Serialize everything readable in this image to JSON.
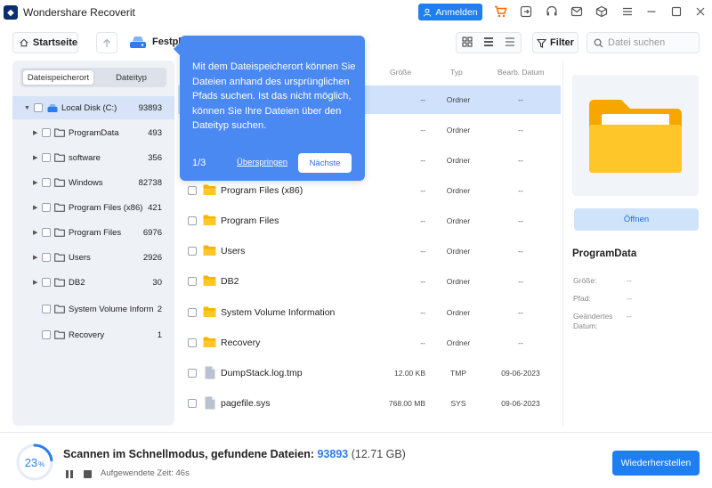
{
  "app": {
    "title": "Wondershare Recoverit",
    "login_label": "Anmelden"
  },
  "toolbar": {
    "home_label": "Startseite",
    "drive_label": "Festpla",
    "filter_label": "Filter",
    "search_placeholder": "Datei suchen"
  },
  "left": {
    "tabs": [
      {
        "label": "Dateispeicherort",
        "active": true
      },
      {
        "label": "Dateityp",
        "active": false
      }
    ],
    "root": {
      "label": "Local Disk (C:)",
      "count": "93893"
    },
    "items": [
      {
        "label": "ProgramData",
        "count": "493",
        "expandable": true
      },
      {
        "label": "software",
        "count": "356",
        "expandable": true
      },
      {
        "label": "Windows",
        "count": "82738",
        "expandable": true
      },
      {
        "label": "Program Files (x86)",
        "count": "421",
        "expandable": true
      },
      {
        "label": "Program Files",
        "count": "6976",
        "expandable": true
      },
      {
        "label": "Users",
        "count": "2926",
        "expandable": true
      },
      {
        "label": "DB2",
        "count": "30",
        "expandable": true
      },
      {
        "label": "System Volume Inform...",
        "count": "2",
        "expandable": false
      },
      {
        "label": "Recovery",
        "count": "1",
        "expandable": false
      }
    ]
  },
  "list": {
    "headers": {
      "size": "Größe",
      "type": "Typ",
      "date": "Bearb. Datum"
    },
    "rows": [
      {
        "name": "",
        "size": "--",
        "type": "Ordner",
        "date": "--",
        "kind": "hidden"
      },
      {
        "name": "",
        "size": "--",
        "type": "Ordner",
        "date": "--",
        "kind": "hidden"
      },
      {
        "name": "",
        "size": "--",
        "type": "Ordner",
        "date": "--",
        "kind": "hidden"
      },
      {
        "name": "Program Files (x86)",
        "size": "--",
        "type": "Ordner",
        "date": "--",
        "kind": "folder"
      },
      {
        "name": "Program Files",
        "size": "--",
        "type": "Ordner",
        "date": "--",
        "kind": "folder"
      },
      {
        "name": "Users",
        "size": "--",
        "type": "Ordner",
        "date": "--",
        "kind": "folder"
      },
      {
        "name": "DB2",
        "size": "--",
        "type": "Ordner",
        "date": "--",
        "kind": "folder"
      },
      {
        "name": "System Volume Information",
        "size": "--",
        "type": "Ordner",
        "date": "--",
        "kind": "folder"
      },
      {
        "name": "Recovery",
        "size": "--",
        "type": "Ordner",
        "date": "--",
        "kind": "folder"
      },
      {
        "name": "DumpStack.log.tmp",
        "size": "12.00 KB",
        "type": "TMP",
        "date": "09-06-2023",
        "kind": "file"
      },
      {
        "name": "pagefile.sys",
        "size": "768.00 MB",
        "type": "SYS",
        "date": "09-06-2023",
        "kind": "file"
      }
    ]
  },
  "tooltip": {
    "text": "Mit dem Dateispeicherort können Sie Dateien anhand des ursprünglichen Pfads suchen. Ist das nicht möglich, können Sie Ihre Dateien über den Dateityp suchen.",
    "step": "1/3",
    "skip_label": "Überspringen",
    "next_label": "Nächste"
  },
  "detail": {
    "open_label": "Öffnen",
    "name": "ProgramData",
    "size_label": "Größe:",
    "size_value": "--",
    "path_label": "Pfad:",
    "path_value": "--",
    "modified_label": "Geändertes Datum:",
    "modified_value": "--"
  },
  "status": {
    "percent": "23",
    "percent_unit": "%",
    "progress": 0.23,
    "scan_prefix": "Scannen im Schnellmodus, gefundene Dateien: ",
    "found_count": "93893",
    "found_size": " (12.71 GB)",
    "elapsed": "Aufgewendete Zeit: 46s",
    "restore_label": "Wiederherstellen"
  },
  "colors": {
    "accent": "#1f7ff0",
    "tooltip": "#4a88f2",
    "folder": "#f7b500"
  }
}
